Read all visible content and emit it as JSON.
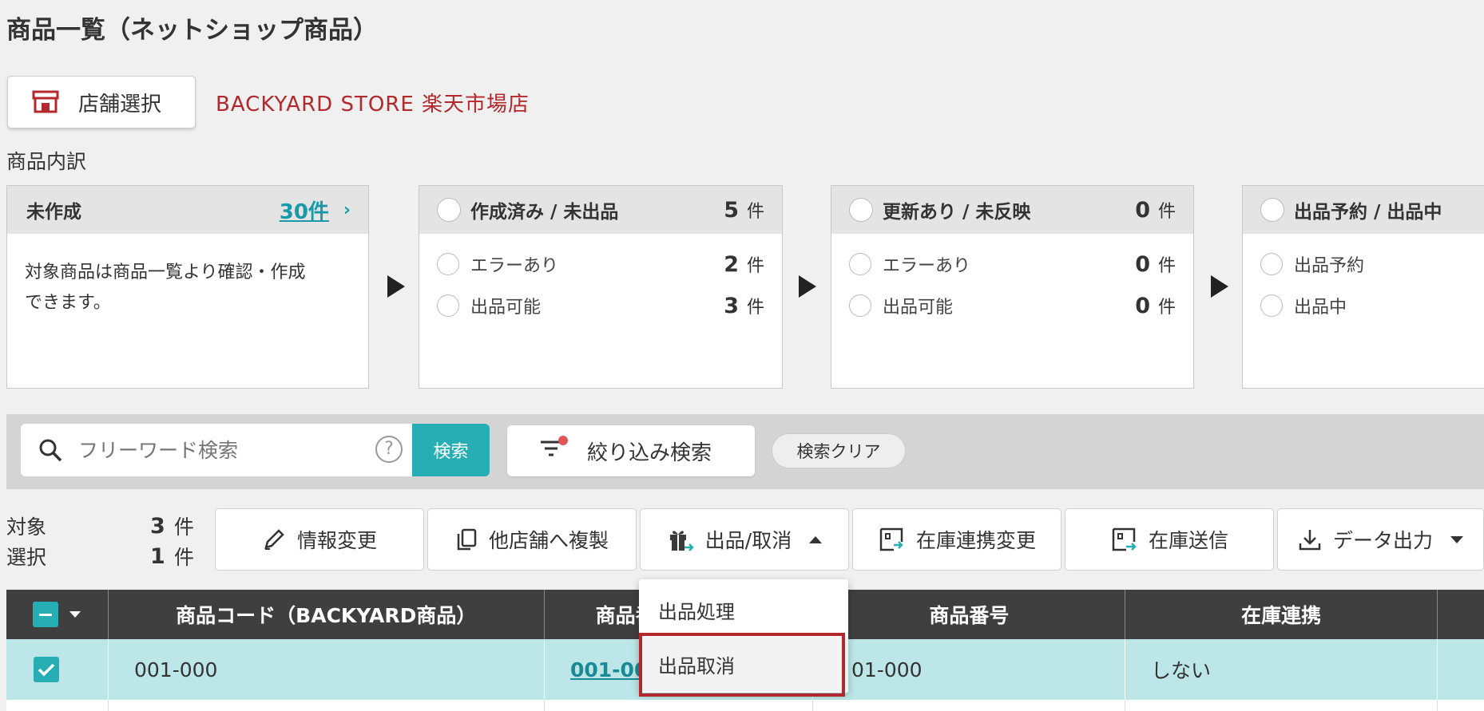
{
  "page_title": "商品一覧（ネットショップ商品）",
  "store": {
    "button_label": "店舗選択",
    "name": "BACKYARD STORE 楽天市場店",
    "accent": "#b3282d"
  },
  "section_label": "商品内訳",
  "cards": {
    "uncreated": {
      "title": "未作成",
      "count_link": "30件",
      "chevron": "›",
      "body": [
        "対象商品は商品一覧より確認・作成",
        "できます。"
      ]
    },
    "created": {
      "title": "作成済み / 未出品",
      "count": "5",
      "unit": "件",
      "rows": [
        {
          "label": "エラーあり",
          "count": "2",
          "unit": "件"
        },
        {
          "label": "出品可能",
          "count": "3",
          "unit": "件"
        }
      ]
    },
    "updated": {
      "title": "更新あり / 未反映",
      "count": "0",
      "unit": "件",
      "rows": [
        {
          "label": "エラーあり",
          "count": "0",
          "unit": "件"
        },
        {
          "label": "出品可能",
          "count": "0",
          "unit": "件"
        }
      ]
    },
    "listing": {
      "title": "出品予約 / 出品中",
      "rows": [
        {
          "label": "出品予約"
        },
        {
          "label": "出品中"
        }
      ]
    }
  },
  "search": {
    "placeholder": "フリーワード検索",
    "help": "?",
    "button": "検索",
    "filter_button": "絞り込み検索",
    "clear_button": "検索クリア",
    "accent": "#27aeb5"
  },
  "counts": {
    "target_label": "対象",
    "target_num": "3",
    "target_unit": "件",
    "selected_label": "選択",
    "selected_num": "1",
    "selected_unit": "件"
  },
  "toolbar": {
    "edit": "情報変更",
    "copy": "他店舗へ複製",
    "listing": "出品/取消",
    "stock_link": "在庫連携変更",
    "stock_send": "在庫送信",
    "export": "データ出力"
  },
  "dropdown": {
    "items": [
      "出品処理",
      "出品取消"
    ]
  },
  "table": {
    "headers": [
      "商品コード（BACKYARD商品）",
      "商品番",
      "",
      "商品番号",
      "在庫連携",
      ""
    ],
    "row": {
      "code": "001-000",
      "link": "001-00",
      "number": "01-000",
      "stock": "しない"
    }
  }
}
